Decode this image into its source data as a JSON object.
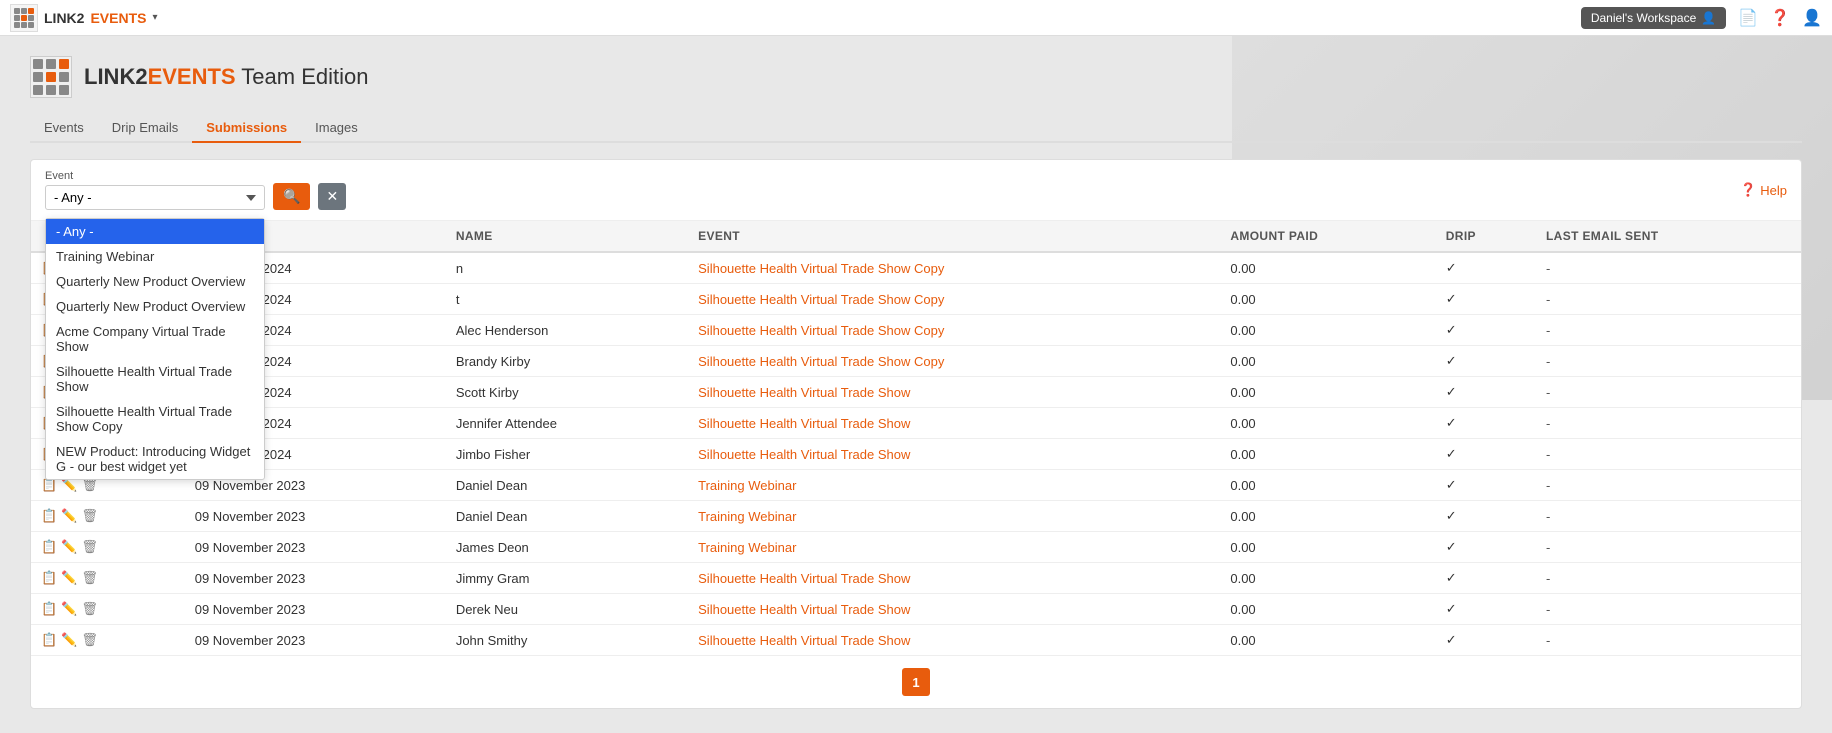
{
  "topbar": {
    "logo_link2": "LINK2",
    "logo_events": "EVENTS",
    "dropdown_caret": "▾",
    "workspace_label": "Daniel's Workspace",
    "workspace_icon": "👤"
  },
  "app": {
    "logo_alt": "L2E",
    "title_link2": "LINK2",
    "title_events": "EVENTS",
    "title_rest": " Team Edition"
  },
  "nav": {
    "tabs": [
      {
        "label": "Events",
        "active": false
      },
      {
        "label": "Drip Emails",
        "active": false
      },
      {
        "label": "Submissions",
        "active": true
      },
      {
        "label": "Images",
        "active": false
      }
    ]
  },
  "filter": {
    "event_label": "Event",
    "event_placeholder": "- Any -",
    "search_icon": "🔍",
    "clear_icon": "✕",
    "help_icon": "❓",
    "help_label": "Help",
    "dropdown_options": [
      {
        "label": "- Any -",
        "selected": true
      },
      {
        "label": "Training Webinar",
        "selected": false
      },
      {
        "label": "Quarterly New Product Overview",
        "selected": false
      },
      {
        "label": "Quarterly New Product Overview",
        "selected": false
      },
      {
        "label": "Acme Company Virtual Trade Show",
        "selected": false
      },
      {
        "label": "Silhouette Health Virtual Trade Show",
        "selected": false
      },
      {
        "label": "Silhouette Health Virtual Trade Show Copy",
        "selected": false
      },
      {
        "label": "NEW Product: Introducing Widget G - our best widget yet",
        "selected": false
      }
    ]
  },
  "table": {
    "columns": [
      "",
      "DATE",
      "NAME",
      "EVENT",
      "AMOUNT PAID",
      "DRIP",
      "LAST EMAIL SENT"
    ],
    "rows": [
      {
        "date": "03 January 2024",
        "name": "n",
        "event": "Silhouette Health Virtual Trade Show Copy",
        "amount": "0.00",
        "drip": "✓",
        "last_email": "-"
      },
      {
        "date": "03 January 2024",
        "name": "t",
        "event": "Silhouette Health Virtual Trade Show Copy",
        "amount": "0.00",
        "drip": "✓",
        "last_email": "-"
      },
      {
        "date": "03 January 2024",
        "name": "Alec Henderson",
        "event": "Silhouette Health Virtual Trade Show Copy",
        "amount": "0.00",
        "drip": "✓",
        "last_email": "-"
      },
      {
        "date": "03 January 2024",
        "name": "Brandy Kirby",
        "event": "Silhouette Health Virtual Trade Show Copy",
        "amount": "0.00",
        "drip": "✓",
        "last_email": "-"
      },
      {
        "date": "03 January 2024",
        "name": "Scott Kirby",
        "event": "Silhouette Health Virtual Trade Show",
        "amount": "0.00",
        "drip": "✓",
        "last_email": "-"
      },
      {
        "date": "03 January 2024",
        "name": "Jennifer Attendee",
        "event": "Silhouette Health Virtual Trade Show",
        "amount": "0.00",
        "drip": "✓",
        "last_email": "-"
      },
      {
        "date": "03 January 2024",
        "name": "Jimbo Fisher",
        "event": "Silhouette Health Virtual Trade Show",
        "amount": "0.00",
        "drip": "✓",
        "last_email": "-"
      },
      {
        "date": "09 November 2023",
        "name": "Daniel Dean",
        "event": "Training Webinar",
        "amount": "0.00",
        "drip": "✓",
        "last_email": "-"
      },
      {
        "date": "09 November 2023",
        "name": "Daniel Dean",
        "event": "Training Webinar",
        "amount": "0.00",
        "drip": "✓",
        "last_email": "-"
      },
      {
        "date": "09 November 2023",
        "name": "James Deon",
        "event": "Training Webinar",
        "amount": "0.00",
        "drip": "✓",
        "last_email": "-"
      },
      {
        "date": "09 November 2023",
        "name": "Jimmy Gram",
        "event": "Silhouette Health Virtual Trade Show",
        "amount": "0.00",
        "drip": "✓",
        "last_email": "-"
      },
      {
        "date": "09 November 2023",
        "name": "Derek Neu",
        "event": "Silhouette Health Virtual Trade Show",
        "amount": "0.00",
        "drip": "✓",
        "last_email": "-"
      },
      {
        "date": "09 November 2023",
        "name": "John Smithy",
        "event": "Silhouette Health Virtual Trade Show",
        "amount": "0.00",
        "drip": "✓",
        "last_email": "-"
      }
    ]
  },
  "pagination": {
    "current_page": "1"
  }
}
